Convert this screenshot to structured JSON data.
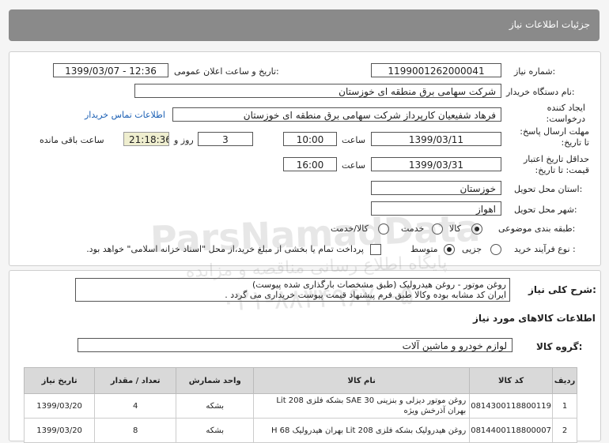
{
  "header": {
    "title": "جزئیات اطلاعات نیاز"
  },
  "form": {
    "need_number_label": "شماره نیاز:",
    "need_number": "1199001262000041",
    "announce_label": "تاریخ و ساعت اعلان عمومی:",
    "announce_value": "1399/03/07 - 12:36",
    "buyer_org_label": "نام دستگاه خریدار:",
    "buyer_org": "شرکت سهامی برق منطقه ای خوزستان",
    "creator_label": "ایجاد کننده درخواست:",
    "creator": "فرهاد شفیعیان کارپرداز شرکت سهامی برق منطقه ای خوزستان",
    "contact_link": "اطلاعات تماس خریدار",
    "send_deadline_label": "مهلت ارسال پاسخ: تا تاریخ:",
    "send_date": "1399/03/11",
    "time_label": "ساعت",
    "send_time": "10:00",
    "days_value": "3",
    "days_label": "روز و",
    "remaining_time": "21:18:36",
    "remaining_label": "ساعت باقی مانده",
    "validity_label": "حداقل تاریخ اعتبار قیمت: تا تاریخ:",
    "validity_date": "1399/03/31",
    "validity_time": "16:00",
    "province_label": "استان محل تحویل:",
    "province": "خوزستان",
    "city_label": "شهر محل تحویل:",
    "city": "اهواز",
    "category_label": "طبقه بندی موضوعی:",
    "category_options": [
      "کالا",
      "خدمت",
      "کالا/خدمت"
    ],
    "process_label": "نوع فرآیند خرید :",
    "process_options": [
      "جزیی",
      "متوسط"
    ],
    "payment_note": "پرداخت تمام یا بخشی از مبلغ خرید،از محل \"اسناد خزانه اسلامی\" خواهد بود."
  },
  "details": {
    "general_desc_label": "شرح کلی نیاز:",
    "general_desc_line1": "روغن موتور - روغن هیدرولیک (طبق مشخصات بارگذاری شده پیوست)",
    "general_desc_line2": "ایران کد مشابه بوده وکالا طبق فرم پیشنهاد قیمت پیوست خریداری می گردد .",
    "goods_info_title": "اطلاعات کالاهای مورد نیاز",
    "goods_group_label": "گروه کالا:",
    "goods_group": "لوازم خودرو و ماشین آلات"
  },
  "table": {
    "headers": [
      "ردیف",
      "کد کالا",
      "نام کالا",
      "واحد شمارش",
      "تعداد / مقدار",
      "تاریخ نیاز"
    ],
    "rows": [
      {
        "row": "1",
        "code": "0814300118800119",
        "name_line1": "روغن موتور دیزلی و بنزینی SAE 30 بشکه فلزی Lit 208",
        "name_line2": "بهران آذرخش ویژه",
        "unit": "بشکه",
        "qty": "4",
        "date": "1399/03/20"
      },
      {
        "row": "2",
        "code": "0814400118800007",
        "name_line1": "روغن هیدرولیک بشکه فلزی Lit 208 بهران هیدرولیک H 68",
        "name_line2": "",
        "unit": "بشکه",
        "qty": "8",
        "date": "1399/03/20"
      }
    ]
  },
  "watermark": {
    "text1": "ParsNamadData",
    "text2": "پایگاه اطلاع رسانی مناقصه و مزایده",
    "text3": "۰۲۱-۸۸۳۴۹۶۷۰-۵"
  }
}
